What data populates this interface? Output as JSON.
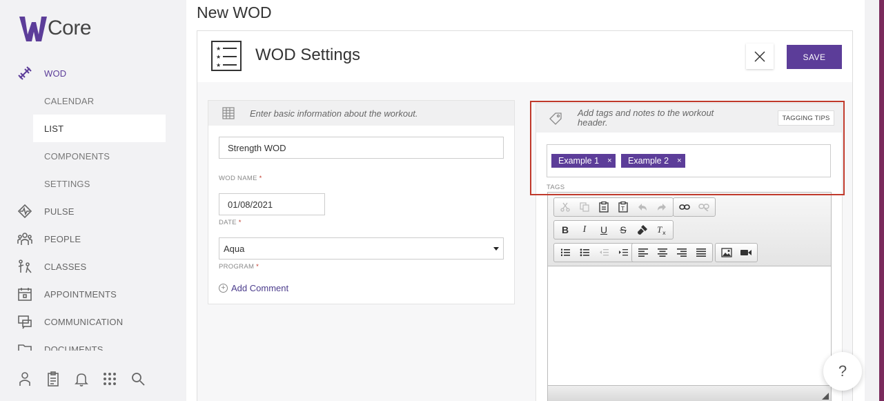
{
  "brand": {
    "name": "Core",
    "accent": "#5c3d99"
  },
  "nav": {
    "wod": "WOD",
    "sub_items": [
      "CALENDAR",
      "LIST",
      "COMPONENTS",
      "SETTINGS"
    ],
    "items": [
      "PULSE",
      "PEOPLE",
      "CLASSES",
      "APPOINTMENTS",
      "COMMUNICATION",
      "DOCUMENTS"
    ]
  },
  "page": {
    "title": "New WOD"
  },
  "card": {
    "title": "WOD Settings",
    "save_label": "SAVE"
  },
  "basic": {
    "header": "Enter basic information about the workout.",
    "title_value": "Strength WOD",
    "wod_name_label": "WOD NAME",
    "date_value": "01/08/2021",
    "date_label": "DATE",
    "program_value": "Aqua",
    "program_label": "PROGRAM",
    "required_mark": "*",
    "add_comment": "Add Comment"
  },
  "tags": {
    "header": "Add  tags  and notes to the workout header.",
    "tips_label": "TAGGING TIPS",
    "items": [
      "Example 1",
      "Example 2"
    ],
    "remove_glyph": "×",
    "label": "TAGS"
  },
  "editor": {
    "bold": "B",
    "italic": "I",
    "underline": "U",
    "strike": "S"
  },
  "help": {
    "label": "?"
  }
}
